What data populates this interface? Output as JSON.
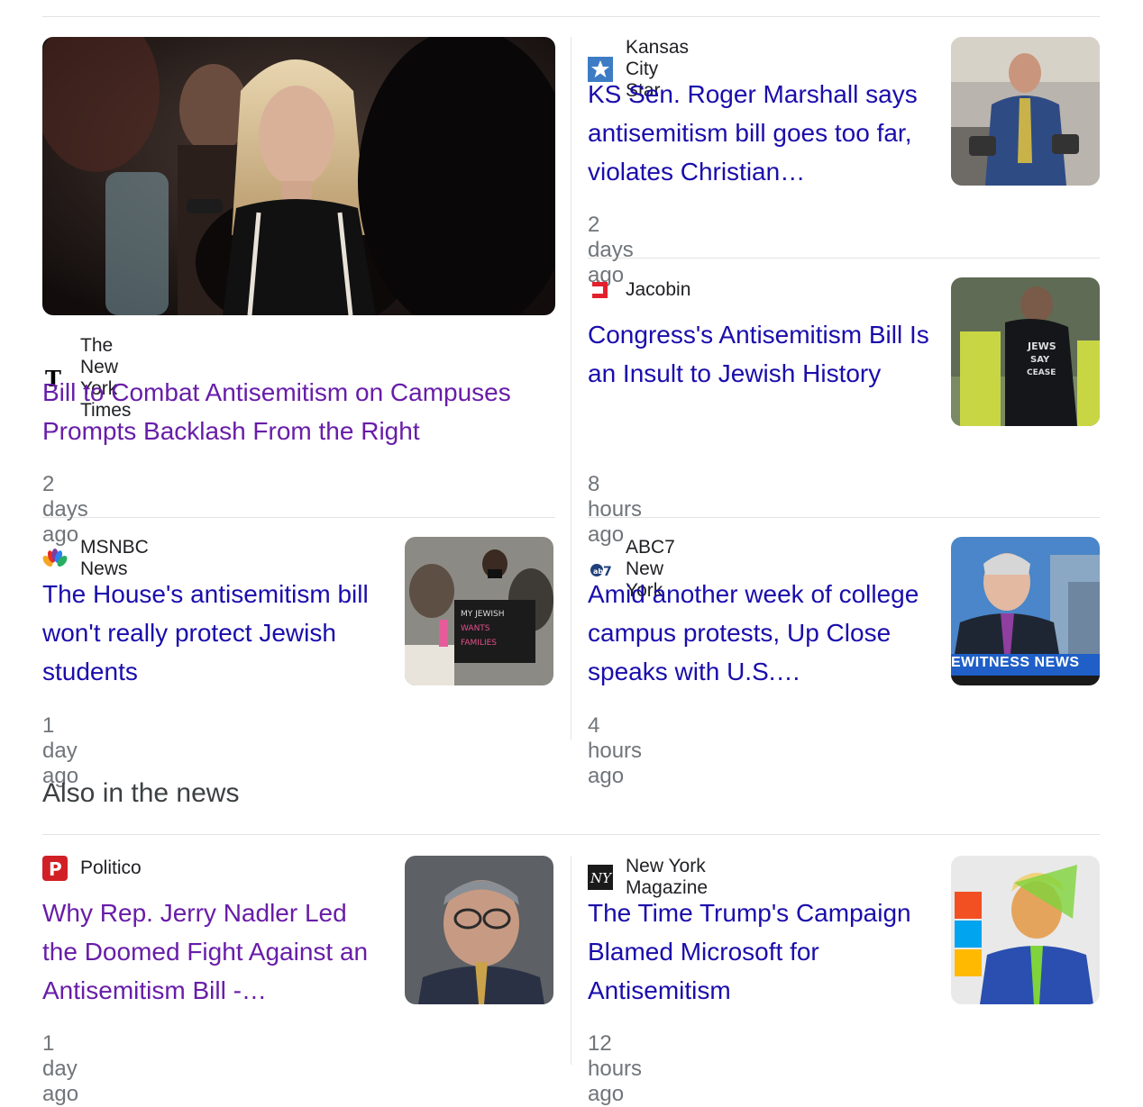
{
  "top_stories": [
    {
      "source": "The New York Times",
      "source_icon": "nyt-logo-icon",
      "title": "Bill to Combat Antisemitism on Campuses Prompts Backlash From the Right",
      "time": "2 days ago",
      "visited": true
    },
    {
      "source": "Kansas City Star",
      "source_icon": "kansas-city-star-icon",
      "title": "KS Sen. Roger Marshall says antisemitism bill goes too far, violates Christian…",
      "time": "2 days ago"
    },
    {
      "source": "Jacobin",
      "source_icon": "jacobin-icon",
      "title": "Congress's Antisemitism Bill Is an Insult to Jewish History",
      "time": "8 hours ago"
    },
    {
      "source": "MSNBC News",
      "source_icon": "nbc-peacock-icon",
      "title": "The House's antisemitism bill won't really protect Jewish students",
      "time": "1 day ago"
    },
    {
      "source": "ABC7 New York",
      "source_icon": "abc7-icon",
      "title": "Amid another week of college campus protests, Up Close speaks with U.S.…",
      "time": "4 hours ago",
      "thumb_caption": "EWITNESS NEWS"
    }
  ],
  "also_in_news": {
    "heading": "Also in the news",
    "items": [
      {
        "source": "Politico",
        "source_icon": "politico-icon",
        "title": "Why Rep. Jerry Nadler Led the Doomed Fight Against an Antisemitism Bill -…",
        "time": "1 day ago",
        "visited": true
      },
      {
        "source": "New York Magazine",
        "source_icon": "nymag-icon",
        "title": "The Time Trump's Campaign Blamed Microsoft for Antisemitism",
        "time": "12 hours ago"
      }
    ]
  },
  "colors": {
    "link": "#1a0dab",
    "visited": "#681da8",
    "meta": "#70757a"
  }
}
